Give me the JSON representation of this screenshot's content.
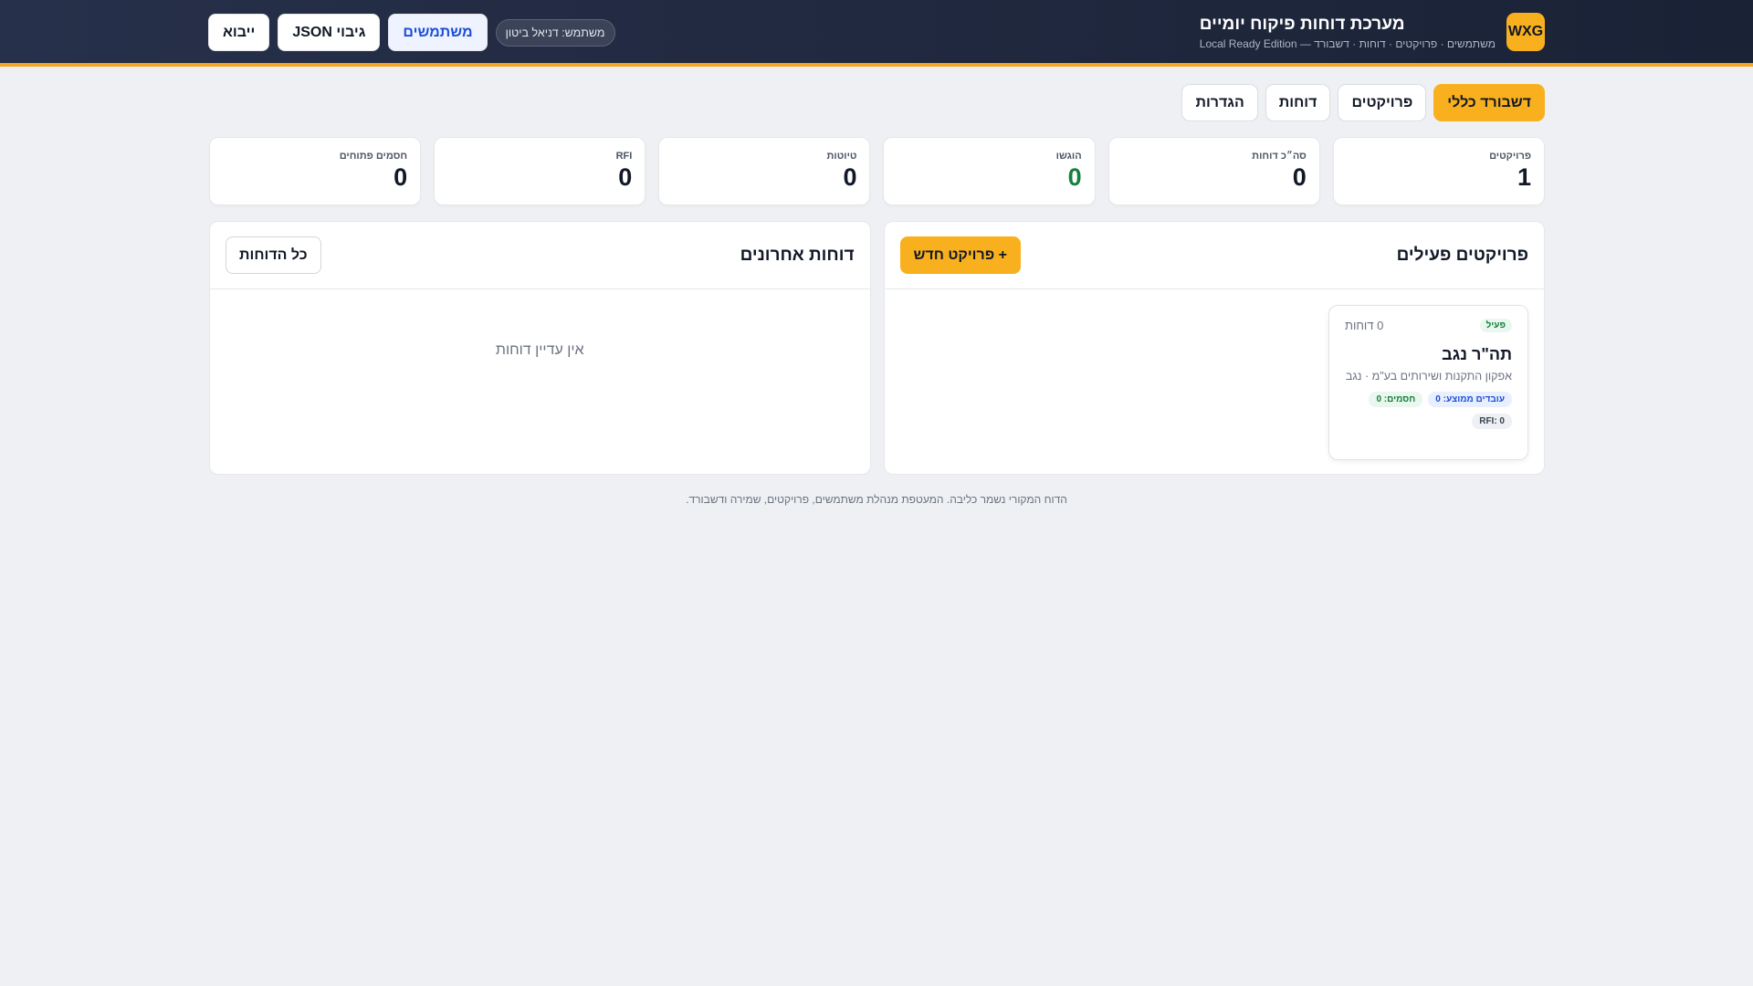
{
  "header": {
    "logo": "WXG",
    "title": "מערכת דוחות פיקוח יומיים",
    "subtitle": "משתמשים · פרויקטים · דוחות · דשבורד — Local Ready Edition",
    "user_label": "משתמש: דניאל ביטון",
    "buttons": {
      "users": "משתמשים",
      "backup_json": "גיבוי JSON",
      "import": "ייבוא"
    },
    "colors": {
      "accent": "#f9b01e",
      "header_bg": "#1f2840"
    }
  },
  "tabs": [
    {
      "label": "דשבורד כללי",
      "active": true
    },
    {
      "label": "פרויקטים",
      "active": false
    },
    {
      "label": "דוחות",
      "active": false
    },
    {
      "label": "הגדרות",
      "active": false
    }
  ],
  "stats": [
    {
      "label": "פרויקטים",
      "value": "1"
    },
    {
      "label": "סה״כ דוחות",
      "value": "0"
    },
    {
      "label": "הוגשו",
      "value": "0"
    },
    {
      "label": "טיוטות",
      "value": "0"
    },
    {
      "label": "RFI",
      "value": "0"
    },
    {
      "label": "חסמים פתוחים",
      "value": "0"
    }
  ],
  "active_projects": {
    "title": "פרויקטים פעילים",
    "new_button": "+ פרויקט חדש",
    "projects": [
      {
        "status": "פעיל",
        "reports": "0 דוחות",
        "name": "תה\"ר נגב",
        "description": "אפקון התקנות ושירותים בע\"מ · נגב",
        "workers": "עובדים ממוצע: 0",
        "blockers": "חסמים: 0",
        "rfi": "RFI: 0"
      }
    ]
  },
  "recent_reports": {
    "title": "דוחות אחרונים",
    "all_button": "כל הדוחות",
    "empty": "אין עדיין דוחות"
  },
  "footer": "הדוח המקורי נשמר כליבה. המעטפת מנהלת משתמשים, פרויקטים, שמירה ודשבורד."
}
